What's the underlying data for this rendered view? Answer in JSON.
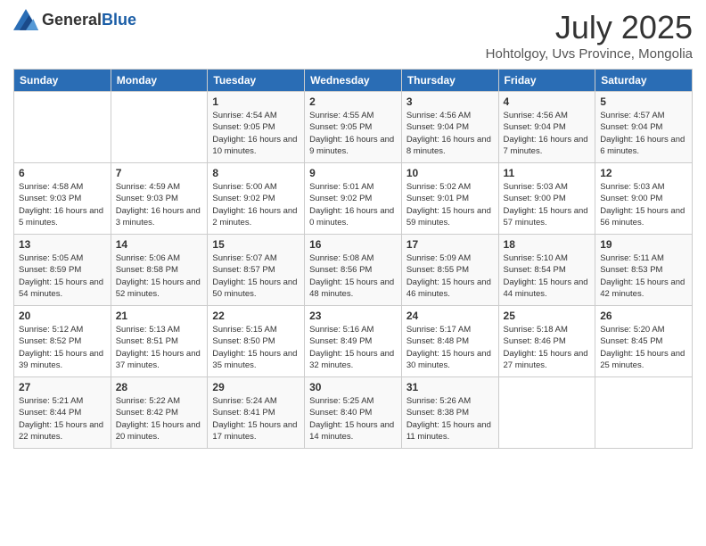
{
  "header": {
    "logo_general": "General",
    "logo_blue": "Blue",
    "month_title": "July 2025",
    "subtitle": "Hohtolgoy, Uvs Province, Mongolia"
  },
  "weekdays": [
    "Sunday",
    "Monday",
    "Tuesday",
    "Wednesday",
    "Thursday",
    "Friday",
    "Saturday"
  ],
  "weeks": [
    [
      {
        "day": "",
        "info": ""
      },
      {
        "day": "",
        "info": ""
      },
      {
        "day": "1",
        "info": "Sunrise: 4:54 AM\nSunset: 9:05 PM\nDaylight: 16 hours and 10 minutes."
      },
      {
        "day": "2",
        "info": "Sunrise: 4:55 AM\nSunset: 9:05 PM\nDaylight: 16 hours and 9 minutes."
      },
      {
        "day": "3",
        "info": "Sunrise: 4:56 AM\nSunset: 9:04 PM\nDaylight: 16 hours and 8 minutes."
      },
      {
        "day": "4",
        "info": "Sunrise: 4:56 AM\nSunset: 9:04 PM\nDaylight: 16 hours and 7 minutes."
      },
      {
        "day": "5",
        "info": "Sunrise: 4:57 AM\nSunset: 9:04 PM\nDaylight: 16 hours and 6 minutes."
      }
    ],
    [
      {
        "day": "6",
        "info": "Sunrise: 4:58 AM\nSunset: 9:03 PM\nDaylight: 16 hours and 5 minutes."
      },
      {
        "day": "7",
        "info": "Sunrise: 4:59 AM\nSunset: 9:03 PM\nDaylight: 16 hours and 3 minutes."
      },
      {
        "day": "8",
        "info": "Sunrise: 5:00 AM\nSunset: 9:02 PM\nDaylight: 16 hours and 2 minutes."
      },
      {
        "day": "9",
        "info": "Sunrise: 5:01 AM\nSunset: 9:02 PM\nDaylight: 16 hours and 0 minutes."
      },
      {
        "day": "10",
        "info": "Sunrise: 5:02 AM\nSunset: 9:01 PM\nDaylight: 15 hours and 59 minutes."
      },
      {
        "day": "11",
        "info": "Sunrise: 5:03 AM\nSunset: 9:00 PM\nDaylight: 15 hours and 57 minutes."
      },
      {
        "day": "12",
        "info": "Sunrise: 5:03 AM\nSunset: 9:00 PM\nDaylight: 15 hours and 56 minutes."
      }
    ],
    [
      {
        "day": "13",
        "info": "Sunrise: 5:05 AM\nSunset: 8:59 PM\nDaylight: 15 hours and 54 minutes."
      },
      {
        "day": "14",
        "info": "Sunrise: 5:06 AM\nSunset: 8:58 PM\nDaylight: 15 hours and 52 minutes."
      },
      {
        "day": "15",
        "info": "Sunrise: 5:07 AM\nSunset: 8:57 PM\nDaylight: 15 hours and 50 minutes."
      },
      {
        "day": "16",
        "info": "Sunrise: 5:08 AM\nSunset: 8:56 PM\nDaylight: 15 hours and 48 minutes."
      },
      {
        "day": "17",
        "info": "Sunrise: 5:09 AM\nSunset: 8:55 PM\nDaylight: 15 hours and 46 minutes."
      },
      {
        "day": "18",
        "info": "Sunrise: 5:10 AM\nSunset: 8:54 PM\nDaylight: 15 hours and 44 minutes."
      },
      {
        "day": "19",
        "info": "Sunrise: 5:11 AM\nSunset: 8:53 PM\nDaylight: 15 hours and 42 minutes."
      }
    ],
    [
      {
        "day": "20",
        "info": "Sunrise: 5:12 AM\nSunset: 8:52 PM\nDaylight: 15 hours and 39 minutes."
      },
      {
        "day": "21",
        "info": "Sunrise: 5:13 AM\nSunset: 8:51 PM\nDaylight: 15 hours and 37 minutes."
      },
      {
        "day": "22",
        "info": "Sunrise: 5:15 AM\nSunset: 8:50 PM\nDaylight: 15 hours and 35 minutes."
      },
      {
        "day": "23",
        "info": "Sunrise: 5:16 AM\nSunset: 8:49 PM\nDaylight: 15 hours and 32 minutes."
      },
      {
        "day": "24",
        "info": "Sunrise: 5:17 AM\nSunset: 8:48 PM\nDaylight: 15 hours and 30 minutes."
      },
      {
        "day": "25",
        "info": "Sunrise: 5:18 AM\nSunset: 8:46 PM\nDaylight: 15 hours and 27 minutes."
      },
      {
        "day": "26",
        "info": "Sunrise: 5:20 AM\nSunset: 8:45 PM\nDaylight: 15 hours and 25 minutes."
      }
    ],
    [
      {
        "day": "27",
        "info": "Sunrise: 5:21 AM\nSunset: 8:44 PM\nDaylight: 15 hours and 22 minutes."
      },
      {
        "day": "28",
        "info": "Sunrise: 5:22 AM\nSunset: 8:42 PM\nDaylight: 15 hours and 20 minutes."
      },
      {
        "day": "29",
        "info": "Sunrise: 5:24 AM\nSunset: 8:41 PM\nDaylight: 15 hours and 17 minutes."
      },
      {
        "day": "30",
        "info": "Sunrise: 5:25 AM\nSunset: 8:40 PM\nDaylight: 15 hours and 14 minutes."
      },
      {
        "day": "31",
        "info": "Sunrise: 5:26 AM\nSunset: 8:38 PM\nDaylight: 15 hours and 11 minutes."
      },
      {
        "day": "",
        "info": ""
      },
      {
        "day": "",
        "info": ""
      }
    ]
  ]
}
